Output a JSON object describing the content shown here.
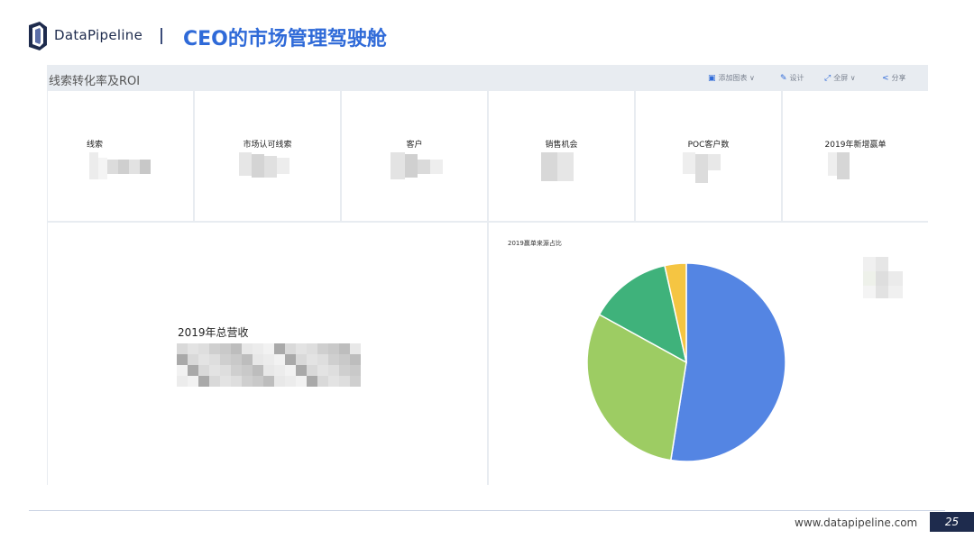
{
  "header": {
    "brand": "DataPipeline",
    "title": "CEO的市场管理驾驶舱"
  },
  "toolbar": {
    "title": "线索转化率及ROI",
    "buttons": [
      {
        "label": "添加图表 ∨",
        "icon": "chart-icon"
      },
      {
        "label": "设计",
        "icon": "design-icon"
      },
      {
        "label": "全屏 ∨",
        "icon": "fullscreen-icon"
      },
      {
        "label": "分享",
        "icon": "share-icon"
      }
    ]
  },
  "kpis": [
    {
      "label": "线索"
    },
    {
      "label": "市场认可线索"
    },
    {
      "label": "客户"
    },
    {
      "label": "销售机会"
    },
    {
      "label": "POC客户数"
    },
    {
      "label": "2019年新增赢单"
    }
  ],
  "revenue": {
    "label": "2019年总营收"
  },
  "chart_data": {
    "type": "pie",
    "title": "2019赢单来源占比",
    "series": [
      {
        "values": [
          52.5,
          30.5,
          13.5,
          3.5
        ]
      }
    ],
    "colors": [
      "#5485e3",
      "#9dcc63",
      "#3fb27b",
      "#f5c542"
    ],
    "start_angle_deg": 0,
    "direction": "clockwise"
  },
  "footer": {
    "url": "www.datapipeline.com",
    "page": "25"
  },
  "colors": {
    "brand_blue": "#2f6ad8",
    "navy": "#1e2b4d"
  }
}
